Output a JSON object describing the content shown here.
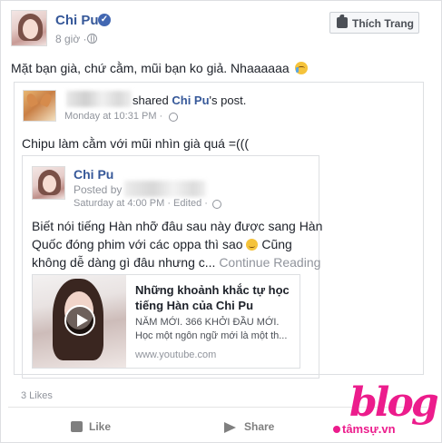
{
  "post": {
    "author": "Chi Pu",
    "time": "8 giờ ·",
    "like_page_label": "Thích Trang",
    "text": "Mặt bạn già, chứ cằm, mũi bạn ko giả. Nhaaaaaa"
  },
  "shared": {
    "shared_verb": "shared",
    "original_author": "Chi Pu",
    "post_word": "'s post.",
    "time": "Monday at 10:31 PM · ",
    "text": "Chipu làm cằm với mũi nhìn già quá =((("
  },
  "original": {
    "author": "Chi Pu",
    "posted_by": "Posted by",
    "time": "Saturday at 4:00 PM · Edited ·",
    "text_lines": [
      "Biết nói tiếng Hàn nhỡ đâu sau này được sang Hàn",
      "Quốc đóng phim với các oppa thì sao",
      "không dễ dàng gì đâu nhưng c..."
    ],
    "line2_suffix": " Cũng",
    "continue_label": "Continue Reading"
  },
  "attachment": {
    "title": "Những khoảnh khắc tự học tiếng Hàn của Chi Pu",
    "desc_lines": [
      "NĂM MỚI. 366 KHỞI ĐẦU MỚI.",
      "Học một ngôn ngữ mới là một th..."
    ],
    "domain": "www.youtube.com"
  },
  "footer": {
    "likes": "3 Likes",
    "like_label": "Like",
    "share_label": "Share"
  },
  "watermark": {
    "word": "blog",
    "sub": "tâmsự.vn"
  },
  "icons": {
    "verified": "verified-badge-icon",
    "globe": "globe-icon",
    "play": "play-icon",
    "thumb": "thumbs-up-icon",
    "share": "share-arrow-icon"
  },
  "colors": {
    "link_blue": "#365899",
    "meta_gray": "#90949c",
    "watermark_pink": "#ec1c8c"
  }
}
